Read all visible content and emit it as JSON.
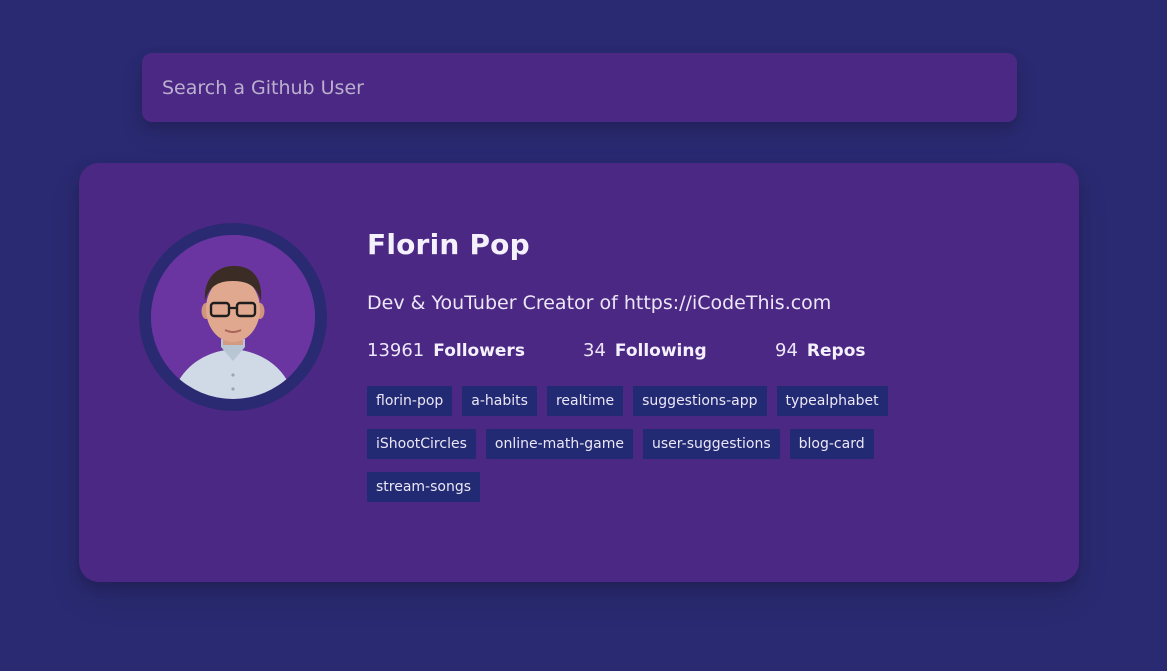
{
  "search": {
    "placeholder": "Search a Github User",
    "value": ""
  },
  "user": {
    "name": "Florin Pop",
    "bio": "Dev & YouTuber Creator of https://iCodeThis.com",
    "followers": {
      "value": "13961",
      "label": "Followers"
    },
    "following": {
      "value": "34",
      "label": "Following"
    },
    "repos_count": {
      "value": "94",
      "label": "Repos"
    }
  },
  "repos": [
    "florin-pop",
    "a-habits",
    "realtime",
    "suggestions-app",
    "typealphabet",
    "iShootCircles",
    "online-math-game",
    "user-suggestions",
    "blog-card",
    "stream-songs"
  ],
  "colors": {
    "background": "#2a2a72",
    "card": "#4c2885",
    "repo_chip": "#212a72",
    "avatar_ring": "#2a2a72"
  }
}
